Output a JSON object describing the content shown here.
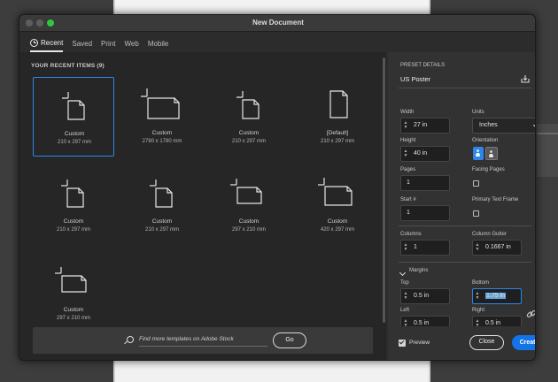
{
  "window": {
    "title": "New Document"
  },
  "tabs": [
    {
      "label": "Recent",
      "active": true
    },
    {
      "label": "Saved"
    },
    {
      "label": "Print"
    },
    {
      "label": "Web"
    },
    {
      "label": "Mobile"
    }
  ],
  "recent": {
    "heading": "YOUR RECENT ITEMS (9)",
    "items": [
      {
        "name": "Custom",
        "size": "210 x 297 mm",
        "orientation": "portrait",
        "selected": true
      },
      {
        "name": "Custom",
        "size": "2780 x 1780 mm",
        "orientation": "landscape"
      },
      {
        "name": "Custom",
        "size": "210 x 297 mm",
        "orientation": "portrait"
      },
      {
        "name": "[Default]",
        "size": "210 x 297 mm",
        "orientation": "portrait-default"
      },
      {
        "name": "Custom",
        "size": "210 x 297 mm",
        "orientation": "portrait"
      },
      {
        "name": "Custom",
        "size": "210 x 297 mm",
        "orientation": "portrait"
      },
      {
        "name": "Custom",
        "size": "297 x 210 mm",
        "orientation": "landscape"
      },
      {
        "name": "Custom",
        "size": "420 x 297 mm",
        "orientation": "landscape"
      },
      {
        "name": "Custom",
        "size": "297 x 210 mm",
        "orientation": "landscape"
      }
    ]
  },
  "search": {
    "placeholder": "Find more templates on Adobe Stock",
    "go_label": "Go"
  },
  "preset": {
    "section_label": "PRESET DETAILS",
    "name": "US Poster",
    "width_label": "Width",
    "width_value": "27 in",
    "units_label": "Units",
    "units_value": "Inches",
    "height_label": "Height",
    "height_value": "40 in",
    "orientation_label": "Orientation",
    "pages_label": "Pages",
    "pages_value": "1",
    "facing_label": "Facing Pages",
    "start_label": "Start #",
    "start_value": "1",
    "primary_label": "Primary Text Frame",
    "columns_label": "Columns",
    "columns_value": "1",
    "gutter_label": "Column Gutter",
    "gutter_value": "0.1667 in",
    "margins_label": "Margins",
    "top_label": "Top",
    "top_value": "0.5 in",
    "bottom_label": "Bottom",
    "bottom_value": "1.75 in",
    "left_label": "Left",
    "left_value": "0.5 in",
    "right_label": "Right",
    "right_value": "0.5 in"
  },
  "footer": {
    "preview_label": "Preview",
    "close_label": "Close",
    "create_label": "Create"
  },
  "colors": {
    "accent": "#1473e6",
    "selection": "#2d86e8"
  }
}
